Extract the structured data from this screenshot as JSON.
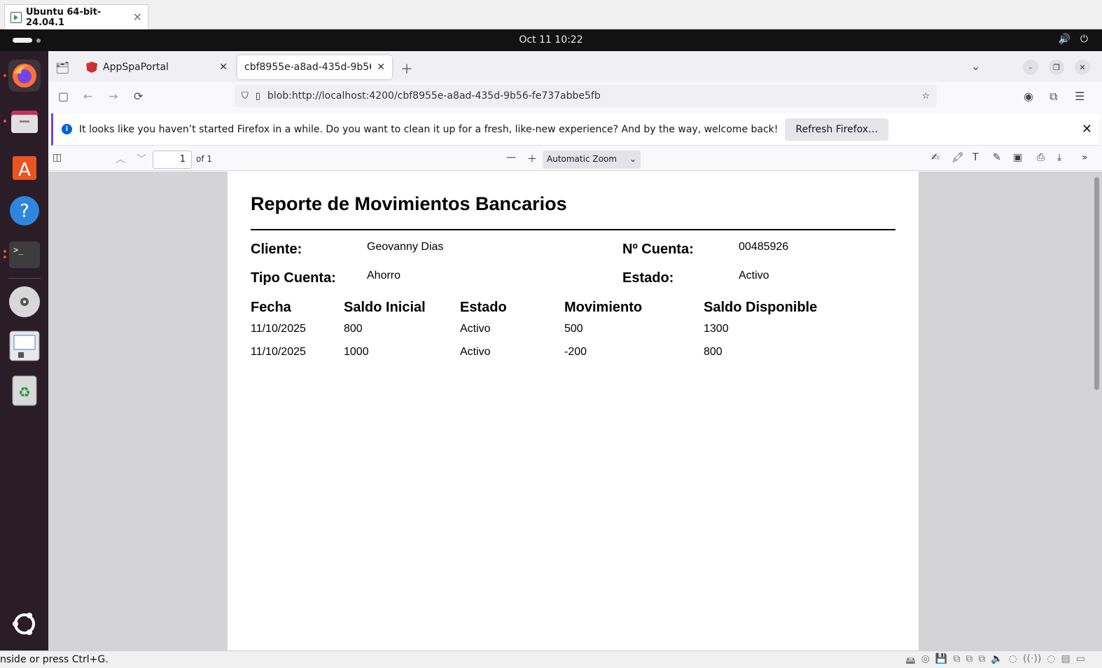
{
  "vm": {
    "tab_title": "Ubuntu 64-bit-24.04.1",
    "status_hint": "nside or press Ctrl+G."
  },
  "topbar": {
    "clock": "Oct 11  10:22"
  },
  "browser": {
    "tabs": [
      {
        "label": "AppSpaPortal"
      },
      {
        "label": "cbf8955e-a8ad-435d-9b56-fe737abbe5fb"
      }
    ],
    "url": "blob:http://localhost:4200/cbf8955e-a8ad-435d-9b56-fe737abbe5fb",
    "notice": {
      "text": "It looks like you haven’t started Firefox in a while. Do you want to clean it up for a fresh, like-new experience? And by the way, welcome back!",
      "button_label": "Refresh Firefox…"
    }
  },
  "pdf_toolbar": {
    "page_number": "1",
    "page_count": "of 1",
    "zoom": "Automatic Zoom"
  },
  "report": {
    "title": "Reporte de Movimientos Bancarios",
    "fields": {
      "cliente_label": "Cliente:",
      "cliente_value": "Geovanny Dias",
      "cuenta_label": "Nº Cuenta:",
      "cuenta_value": "00485926",
      "tipo_label": "Tipo Cuenta:",
      "tipo_value": "Ahorro",
      "estado_label": "Estado:",
      "estado_value": "Activo"
    },
    "columns": [
      "Fecha",
      "Saldo Inicial",
      "Estado",
      "Movimiento",
      "Saldo Disponible"
    ],
    "rows": [
      [
        "11/10/2025",
        "800",
        "Activo",
        "500",
        "1300"
      ],
      [
        "11/10/2025",
        "1000",
        "Activo",
        "-200",
        "800"
      ]
    ]
  }
}
